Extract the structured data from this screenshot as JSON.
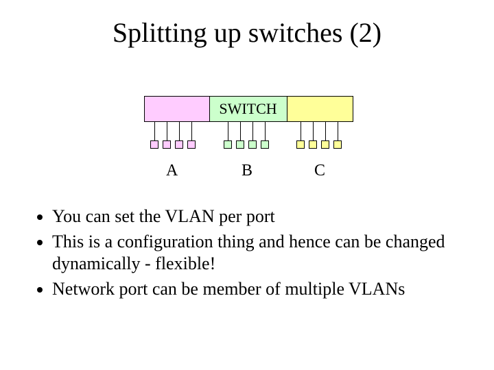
{
  "title": "Splitting up switches (2)",
  "switch_label": "SWITCH",
  "vlans": {
    "a": "A",
    "b": "B",
    "c": "C"
  },
  "bullets": {
    "b1": "You can set the VLAN per port",
    "b2": "This is a configuration thing and hence can be changed dynamically - flexible!",
    "b3": "Network port can be member of multiple VLANs"
  }
}
